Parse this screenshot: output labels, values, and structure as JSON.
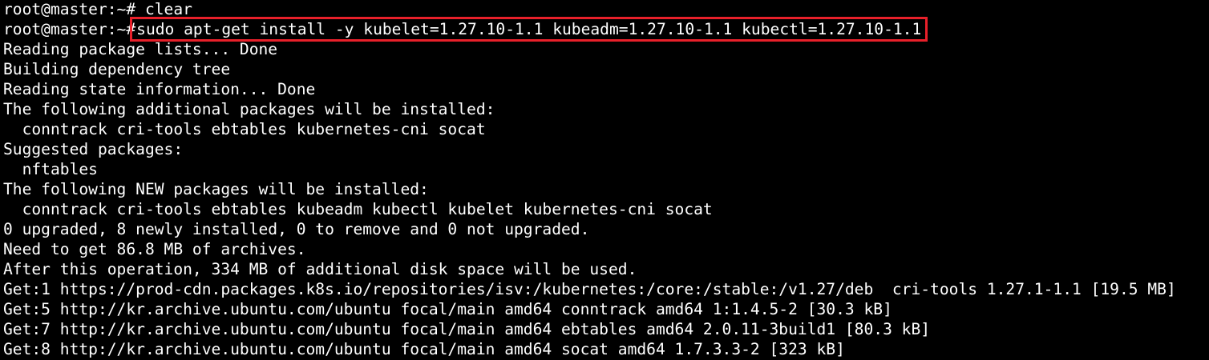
{
  "colors": {
    "background": "#000000",
    "foreground": "#ffffff",
    "highlight_box": "#e8202a"
  },
  "terminal": {
    "prompt": "root@master:~#",
    "previous_command": "clear",
    "highlighted_command": "sudo apt-get install -y kubelet=1.27.10-1.1 kubeadm=1.27.10-1.1 kubectl=1.27.10-1.1",
    "output_lines": [
      "Reading package lists... Done",
      "Building dependency tree",
      "Reading state information... Done",
      "The following additional packages will be installed:",
      "  conntrack cri-tools ebtables kubernetes-cni socat",
      "Suggested packages:",
      "  nftables",
      "The following NEW packages will be installed:",
      "  conntrack cri-tools ebtables kubeadm kubectl kubelet kubernetes-cni socat",
      "0 upgraded, 8 newly installed, 0 to remove and 0 not upgraded.",
      "Need to get 86.8 MB of archives.",
      "After this operation, 334 MB of additional disk space will be used.",
      "Get:1 https://prod-cdn.packages.k8s.io/repositories/isv:/kubernetes:/core:/stable:/v1.27/deb  cri-tools 1.27.1-1.1 [19.5 MB]",
      "Get:5 http://kr.archive.ubuntu.com/ubuntu focal/main amd64 conntrack amd64 1:1.4.5-2 [30.3 kB]",
      "Get:7 http://kr.archive.ubuntu.com/ubuntu focal/main amd64 ebtables amd64 2.0.11-3build1 [80.3 kB]",
      "Get:8 http://kr.archive.ubuntu.com/ubuntu focal/main amd64 socat amd64 1.7.3.3-2 [323 kB]"
    ]
  }
}
